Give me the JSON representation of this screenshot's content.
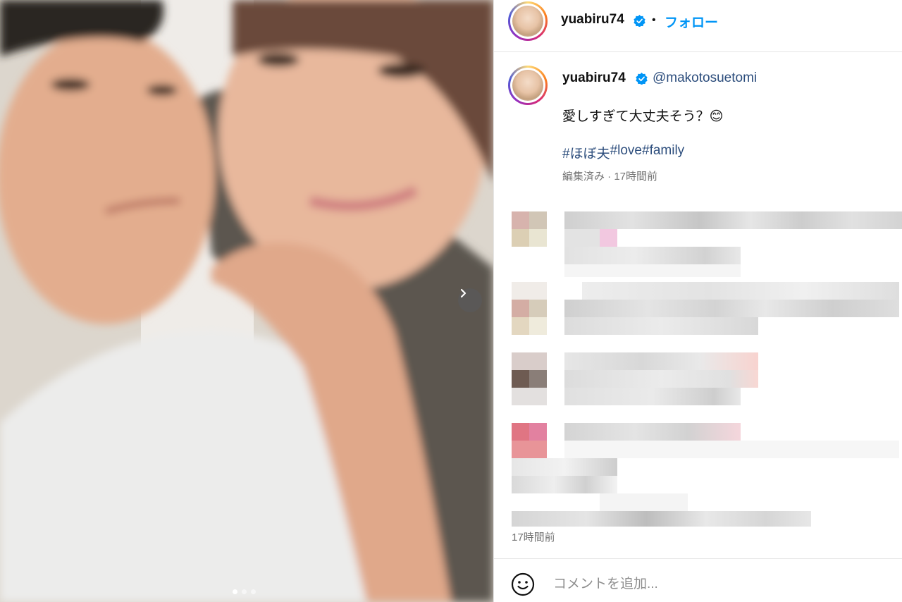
{
  "header": {
    "username": "yuabiru74",
    "separator": "•",
    "follow_label": "フォロー"
  },
  "post": {
    "username": "yuabiru74",
    "mention": "@makotosuetomi",
    "caption": "愛しすぎて大丈夫そう？😊",
    "hashtags": [
      "#ほぼ夫",
      "#love",
      "#family"
    ],
    "meta": "編集済み · 17時間前"
  },
  "comments_timestamp": "17時間前",
  "comment_box": {
    "placeholder": "コメントを追加..."
  },
  "carousel": {
    "total_slides": 3,
    "active_slide": 1
  },
  "colors": {
    "accent": "#0095f6",
    "link": "#2c4d7c",
    "muted": "#737373",
    "verified": "#0095f6"
  },
  "icons": {
    "verified": "verified-badge-icon",
    "next": "chevron-right-icon",
    "emoji": "smiley-face-icon"
  }
}
